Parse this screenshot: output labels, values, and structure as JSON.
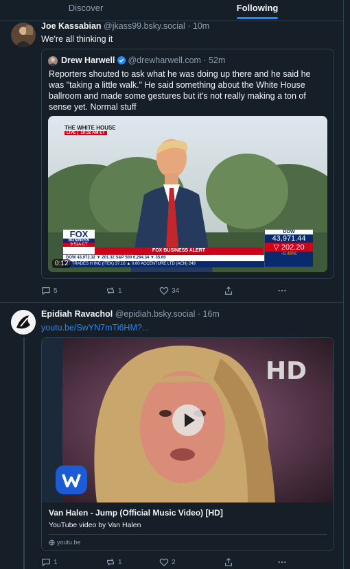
{
  "tabs": [
    {
      "label": "Discover",
      "active": false
    },
    {
      "label": "Following",
      "active": true
    }
  ],
  "posts": [
    {
      "display_name": "Joe Kassabian",
      "handle": "@jkass99.bsky.social",
      "time": "· 10m",
      "text": "We're all thinking it",
      "quote": {
        "display_name": "Drew Harwell",
        "verified": true,
        "handle": "@drewharwell.com",
        "time": "· 52m",
        "text": "Reporters shouted to ask what he was doing up there and he said he was \"taking a little walk.\" He said something about the White House ballroom and made some gestures but it's not really making a ton of sense yet. Normal stuff",
        "video": {
          "duration": "0:12",
          "banner": "THE WHITE HOUSE",
          "live": "LIVE",
          "live_time": "10:32 AM ET",
          "network": "FOX",
          "network_sub": "BUSINESS",
          "local_time": "9:52A CT",
          "alert": "FOX BUSINESS ALERT",
          "ticker_a": "DOW     43,972.32 ▼ 201.32   S&P 500   6,294.34 ▼ 35.60",
          "ticker_b": "AT TRADES   H INC (ITEK)  37.16 ▲ 0.60     ACCENTURE LTD (ACN)  249",
          "dow_label": "DOW",
          "dow_value": "43,971.44",
          "dow_change": "202.20",
          "dow_pct": "-0.46%"
        }
      },
      "replies": "5",
      "reposts": "1",
      "likes": "34"
    },
    {
      "display_name": "Epidiah Ravachol",
      "handle": "@epidiah.bsky.social",
      "time": "· 16m",
      "link_text": "youtu.be/SwYN7mTi6HM?...",
      "card": {
        "hd_label": "HD",
        "title": "Van Halen - Jump (Official Music Video) [HD]",
        "description": "YouTube video by Van Halen",
        "domain": "youtu.be"
      },
      "replies": "1",
      "reposts": "1",
      "likes": "2"
    }
  ],
  "colors": {
    "background": "#161e27",
    "border": "#2e4052",
    "muted": "#8d9fb3",
    "accent": "#208bfe",
    "verified": "#208bfe"
  }
}
